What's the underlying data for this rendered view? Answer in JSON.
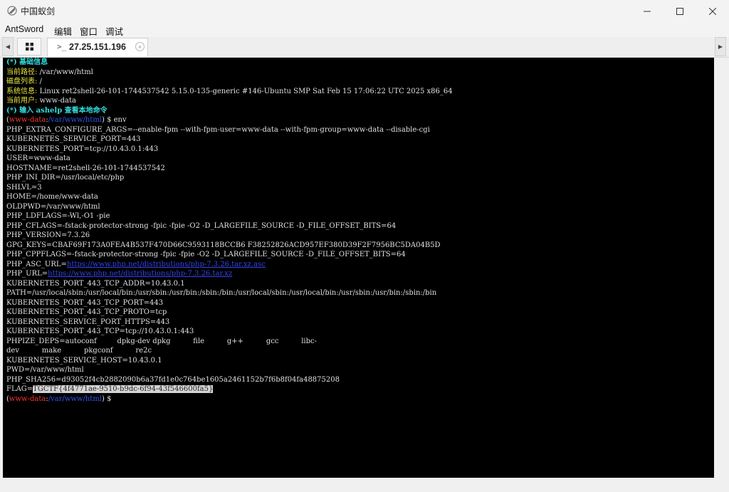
{
  "window": {
    "title": "中国蚁剑",
    "icon": "antsword-icon",
    "controls": [
      "minimize-icon",
      "maximize-icon",
      "close-icon"
    ]
  },
  "menu": [
    {
      "label": "AntSword"
    },
    {
      "label": "编辑"
    },
    {
      "label": "窗口"
    },
    {
      "label": "调试"
    }
  ],
  "tabs": {
    "home_icon": "grid-icon",
    "connection_prompt": ">_",
    "connection_label": "27.25.151.196",
    "close_glyph": "×"
  },
  "terminal": {
    "header": {
      "base_info_title": "(*) 基础信息",
      "path_label": "当前路径:",
      "path_value": "/var/www/html",
      "disks_label": "磁盘列表:",
      "disks_value": "/",
      "sysinfo_label": "系统信息:",
      "sysinfo_value": "Linux ret2shell-26-101-1744537542 5.15.0-135-generic #146-Ubuntu SMP Sat Feb 15 17:06:22 UTC 2025 x86_64",
      "user_label": "当前用户:",
      "user_value": "www-data",
      "help_hint": "(*) 输入 ashelp 查看本地命令"
    },
    "prompt": {
      "user": "www-data",
      "cwd": "/var/www/html",
      "cmd1": "env"
    },
    "env": {
      "l1": "PHP_EXTRA_CONFIGURE_ARGS=--enable-fpm --with-fpm-user=www-data --with-fpm-group=www-data --disable-cgi",
      "l2": "KUBERNETES_SERVICE_PORT=443",
      "l3": "KUBERNETES_PORT=tcp://10.43.0.1:443",
      "l4": "USER=www-data",
      "l5": "HOSTNAME=ret2shell-26-101-1744537542",
      "l6": "PHP_INI_DIR=/usr/local/etc/php",
      "l7": "SHLVL=3",
      "l8": "HOME=/home/www-data",
      "l9": "OLDPWD=/var/www/html",
      "l10": "PHP_LDFLAGS=-Wl,-O1 -pie",
      "l11": "PHP_CFLAGS=-fstack-protector-strong -fpic -fpie -O2 -D_LARGEFILE_SOURCE -D_FILE_OFFSET_BITS=64",
      "l12": "PHP_VERSION=7.3.26",
      "l13": "GPG_KEYS=CBAF69F173A0FEA4B537F470D66C9593118BCCB6 F38252826ACD957EF380D39F2F7956BC5DA04B5D",
      "l14": "PHP_CPPFLAGS=-fstack-protector-strong -fpic -fpie -O2 -D_LARGEFILE_SOURCE -D_FILE_OFFSET_BITS=64",
      "l15_key": "PHP_ASC_URL=",
      "l15_url": "https://www.php.net/distributions/php-7.3.26.tar.xz.asc",
      "l16_key": "PHP_URL=",
      "l16_url": "https://www.php.net/distributions/php-7.3.26.tar.xz",
      "l17": "KUBERNETES_PORT_443_TCP_ADDR=10.43.0.1",
      "l18": "PATH=/usr/local/sbin:/usr/local/bin:/usr/sbin:/usr/bin:/sbin:/bin:/usr/local/sbin:/usr/local/bin:/usr/sbin:/usr/bin:/sbin:/bin",
      "l19": "KUBERNETES_PORT_443_TCP_PORT=443",
      "l20": "KUBERNETES_PORT_443_TCP_PROTO=tcp",
      "l21": "KUBERNETES_SERVICE_PORT_HTTPS=443",
      "l22": "KUBERNETES_PORT_443_TCP=tcp://10.43.0.1:443",
      "l23": "PHPIZE_DEPS=autoconf         dpkg-dev dpkg          file          g++          gcc          libc-",
      "l24": "dev          make          pkgconf          re2c",
      "l25": "KUBERNETES_SERVICE_HOST=10.43.0.1",
      "l26": "PWD=/var/www/html",
      "l27": "PHP_SHA256=d93052f4cb2882090b6a37fd1e0c764be1605a2461152b7f6b8f04fa48875208",
      "l28_key": "FLAG=",
      "l28_value": "TGCTF{4f4771ae-9510-b9dc-6f94-43f546600fa5}"
    }
  }
}
